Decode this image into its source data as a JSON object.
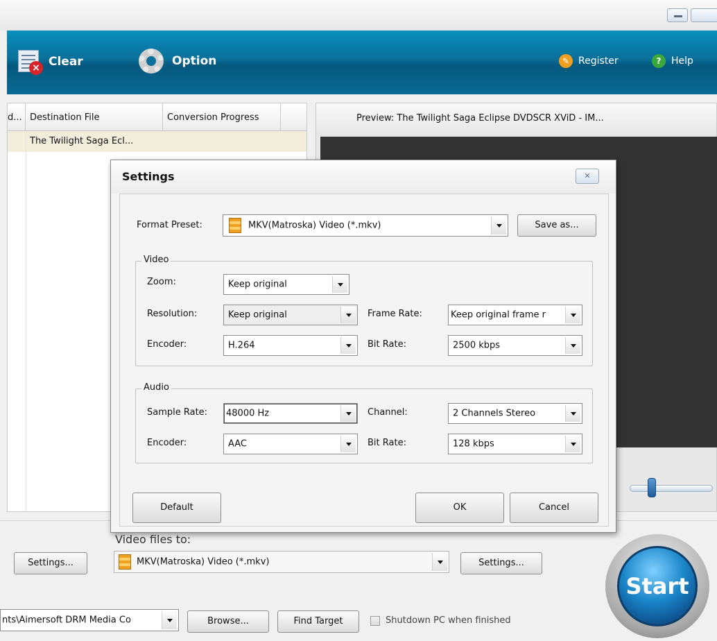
{
  "toolbar": {
    "clear_label": "Clear",
    "option_label": "Option",
    "register_label": "Register",
    "help_label": "Help"
  },
  "file_list": {
    "columns": [
      "d...",
      "Destination File",
      "Conversion Progress"
    ],
    "rows": [
      {
        "destination": "The Twilight Saga Ecl..."
      }
    ]
  },
  "preview": {
    "title": "Preview: The Twilight Saga Eclipse DVDSCR XViD - IM..."
  },
  "settings_dialog": {
    "title": "Settings",
    "close_glyph": "✕",
    "format_preset_label": "Format Preset:",
    "format_preset_value": "MKV(Matroska) Video (*.mkv)",
    "save_as_label": "Save as...",
    "video": {
      "legend": "Video",
      "zoom_label": "Zoom:",
      "zoom_value": "Keep original",
      "resolution_label": "Resolution:",
      "resolution_value": "Keep original",
      "frame_rate_label": "Frame Rate:",
      "frame_rate_value": "Keep original frame r",
      "encoder_label": "Encoder:",
      "encoder_value": "H.264",
      "bit_rate_label": "Bit Rate:",
      "bit_rate_value": "2500 kbps"
    },
    "audio": {
      "legend": "Audio",
      "sample_rate_label": "Sample Rate:",
      "sample_rate_value": "48000 Hz",
      "channel_label": "Channel:",
      "channel_value": "2 Channels Stereo",
      "encoder_label": "Encoder:",
      "encoder_value": "AAC",
      "bit_rate_label": "Bit Rate:",
      "bit_rate_value": "128 kbps"
    },
    "default_label": "Default",
    "ok_label": "OK",
    "cancel_label": "Cancel"
  },
  "bottom": {
    "left_settings_label": "Settings...",
    "video_files_to_label": "Video files to:",
    "output_format_value": "MKV(Matroska) Video (*.mkv)",
    "settings_label": "Settings...",
    "output_folder_value": "nts\\Aimersoft DRM Media Co",
    "browse_label": "Browse...",
    "find_target_label": "Find Target",
    "shutdown_label": "Shutdown PC when finished",
    "start_label": "Start"
  },
  "colors": {
    "toolbar_blue": "#0a6f99",
    "row_highlight": "#f3eedb",
    "start_blue": "#1a86c8"
  },
  "icons": [
    "clear-icon",
    "gear-icon",
    "register-icon",
    "help-icon",
    "mkv-format-icon"
  ]
}
